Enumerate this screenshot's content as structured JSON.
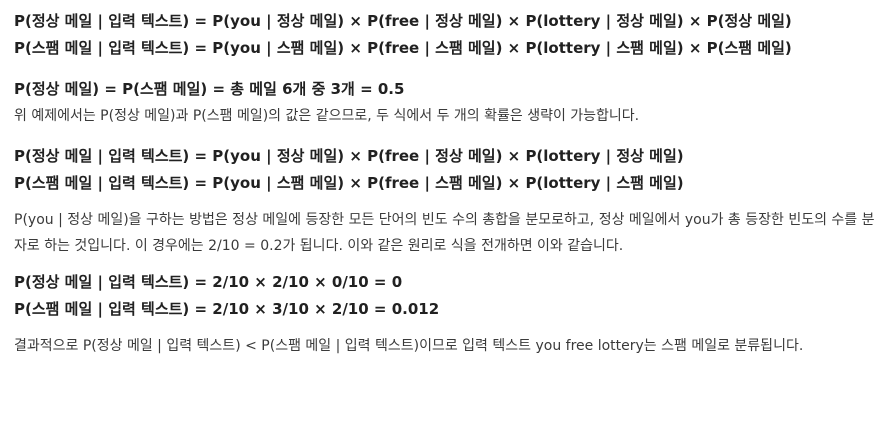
{
  "sections": {
    "likelihood_full": {
      "line1": "P(정상 메일 | 입력 텍스트) = P(you | 정상 메일) × P(free | 정상 메일) × P(lottery | 정상 메일) × P(정상 메일)",
      "line2": "P(스팸 메일 | 입력 텍스트) = P(you | 스팸 메일) × P(free | 스팸 메일) × P(lottery | 스팸 메일) × P(스팸 메일)"
    },
    "prior": {
      "equation": "P(정상 메일) = P(스팸 메일) = 총 메일 6개 중 3개 = 0.5",
      "explanation": "위 예제에서는 P(정상 메일)과 P(스팸 메일)의 값은 같으므로, 두 식에서 두 개의 확률은 생략이 가능합니다."
    },
    "likelihood_reduced": {
      "line1": "P(정상 메일 | 입력 텍스트) = P(you | 정상 메일) × P(free | 정상 메일) × P(lottery | 정상 메일)",
      "line2": "P(스팸 메일 | 입력 텍스트) = P(you | 스팸 메일) × P(free | 스팸 메일) × P(lottery | 스팸 메일)"
    },
    "frequency_explanation": "P(you | 정상 메일)을 구하는 방법은 정상 메일에 등장한 모든 단어의 빈도 수의 총합을 분모로하고, 정상 메일에서 you가 총 등장한 빈도의 수를 분자로 하는 것입니다. 이 경우에는 2/10 = 0.2가 됩니다. 이와 같은 원리로 식을 전개하면 이와 같습니다.",
    "computed": {
      "line1": "P(정상 메일 | 입력 텍스트) = 2/10 × 2/10 × 0/10 = 0",
      "line2": "P(스팸 메일 | 입력 텍스트) = 2/10 × 3/10 × 2/10 = 0.012"
    },
    "conclusion": "결과적으로 P(정상 메일 | 입력 텍스트) < P(스팸 메일 | 입력 텍스트)이므로 입력 텍스트 you free lottery는 스팸 메일로 분류됩니다."
  }
}
